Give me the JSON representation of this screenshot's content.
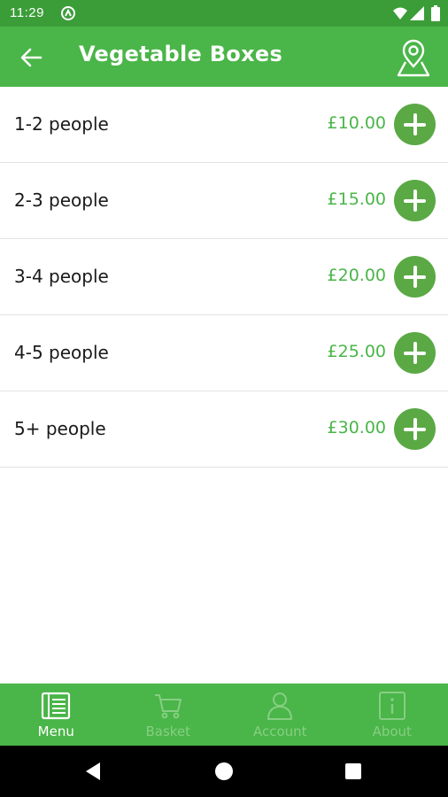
{
  "status_bar": {
    "time": "11:29"
  },
  "app_bar": {
    "title": "Vegetable Boxes"
  },
  "items": [
    {
      "label": "1-2 people",
      "price": "£10.00"
    },
    {
      "label": "2-3 people",
      "price": "£15.00"
    },
    {
      "label": "3-4 people",
      "price": "£20.00"
    },
    {
      "label": "4-5 people",
      "price": "£25.00"
    },
    {
      "label": "5+ people",
      "price": "£30.00"
    }
  ],
  "bottom_nav": {
    "items": [
      {
        "label": "Menu",
        "icon": "menu-book-icon",
        "active": true
      },
      {
        "label": "Basket",
        "icon": "cart-icon",
        "active": false
      },
      {
        "label": "Account",
        "icon": "person-icon",
        "active": false
      },
      {
        "label": "About",
        "icon": "info-icon",
        "active": false
      }
    ]
  },
  "colors": {
    "status_bar": "#3b9d38",
    "app_bar": "#4ab548",
    "accent": "#5aa945",
    "price": "#4ab548"
  }
}
